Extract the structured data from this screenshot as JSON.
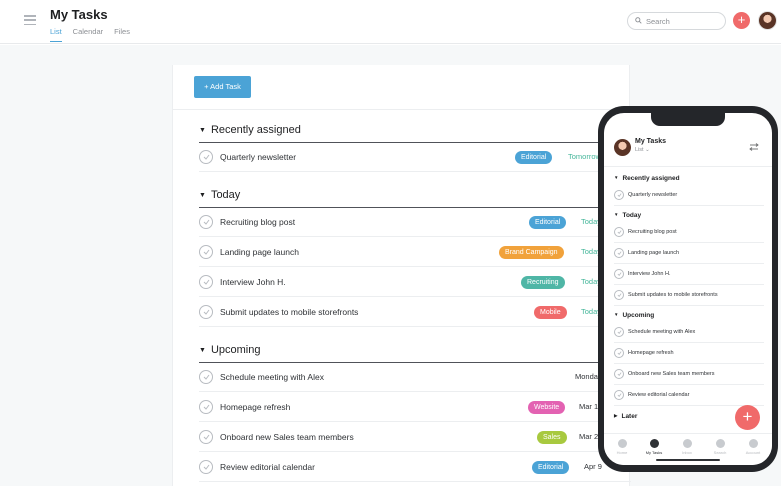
{
  "header": {
    "title": "My Tasks",
    "tabs": [
      "List",
      "Calendar",
      "Files"
    ],
    "active_tab": "List",
    "search_placeholder": "Search"
  },
  "toolbar": {
    "add_task_label": "+ Add Task"
  },
  "sections": [
    {
      "title": "Recently assigned",
      "tasks": [
        {
          "name": "Quarterly newsletter",
          "tag": "Editorial",
          "tag_color": "#4ba3d6",
          "due": "Tomorrow",
          "due_color": "#45b69a"
        }
      ]
    },
    {
      "title": "Today",
      "tasks": [
        {
          "name": "Recruiting blog post",
          "tag": "Editorial",
          "tag_color": "#4ba3d6",
          "due": "Today",
          "due_color": "#45b69a"
        },
        {
          "name": "Landing page launch",
          "tag": "Brand Campaign",
          "tag_color": "#f1a23b",
          "due": "Today",
          "due_color": "#45b69a"
        },
        {
          "name": "Interview John H.",
          "tag": "Recruiting",
          "tag_color": "#4fb6a6",
          "due": "Today",
          "due_color": "#45b69a"
        },
        {
          "name": "Submit updates to mobile storefronts",
          "tag": "Mobile",
          "tag_color": "#f06a6a",
          "due": "Today",
          "due_color": "#45b69a"
        }
      ]
    },
    {
      "title": "Upcoming",
      "tasks": [
        {
          "name": "Schedule meeting with Alex",
          "tag": "",
          "tag_color": "",
          "due": "Monday",
          "due_color": "#2f3236"
        },
        {
          "name": "Homepage refresh",
          "tag": "Website",
          "tag_color": "#e362b2",
          "due": "Mar 1",
          "due_color": "#2f3236"
        },
        {
          "name": "Onboard new Sales team members",
          "tag": "Sales",
          "tag_color": "#a8c93f",
          "due": "Mar 2",
          "due_color": "#2f3236"
        },
        {
          "name": "Review editorial calendar",
          "tag": "Editorial",
          "tag_color": "#4ba3d6",
          "due": "Apr 9",
          "due_color": "#2f3236"
        }
      ]
    }
  ],
  "mobile": {
    "title": "My Tasks",
    "view": "List",
    "sections": [
      {
        "title": "Recently assigned",
        "tasks": [
          "Quarterly newsletter"
        ]
      },
      {
        "title": "Today",
        "tasks": [
          "Recruiting blog post",
          "Landing page launch",
          "Interview John H.",
          "Submit updates to mobile storefronts"
        ]
      },
      {
        "title": "Upcoming",
        "tasks": [
          "Schedule meeting with Alex",
          "Homepage refresh",
          "Onboard new Sales team members",
          "Review editorial calendar"
        ]
      },
      {
        "title": "Later",
        "tasks": []
      }
    ],
    "nav": [
      "Home",
      "My Tasks",
      "Inbox",
      "Search",
      "Account"
    ],
    "active_nav": "My Tasks"
  },
  "colors": {
    "accent": "#4ba3d6",
    "brand": "#f06a6a",
    "due_soon": "#45b69a"
  },
  "icons": [
    "hamburger-icon",
    "search-icon",
    "plus-icon",
    "check-icon",
    "filter-icon",
    "home-icon",
    "check-circle-icon",
    "bell-icon",
    "search-icon",
    "person-icon"
  ]
}
